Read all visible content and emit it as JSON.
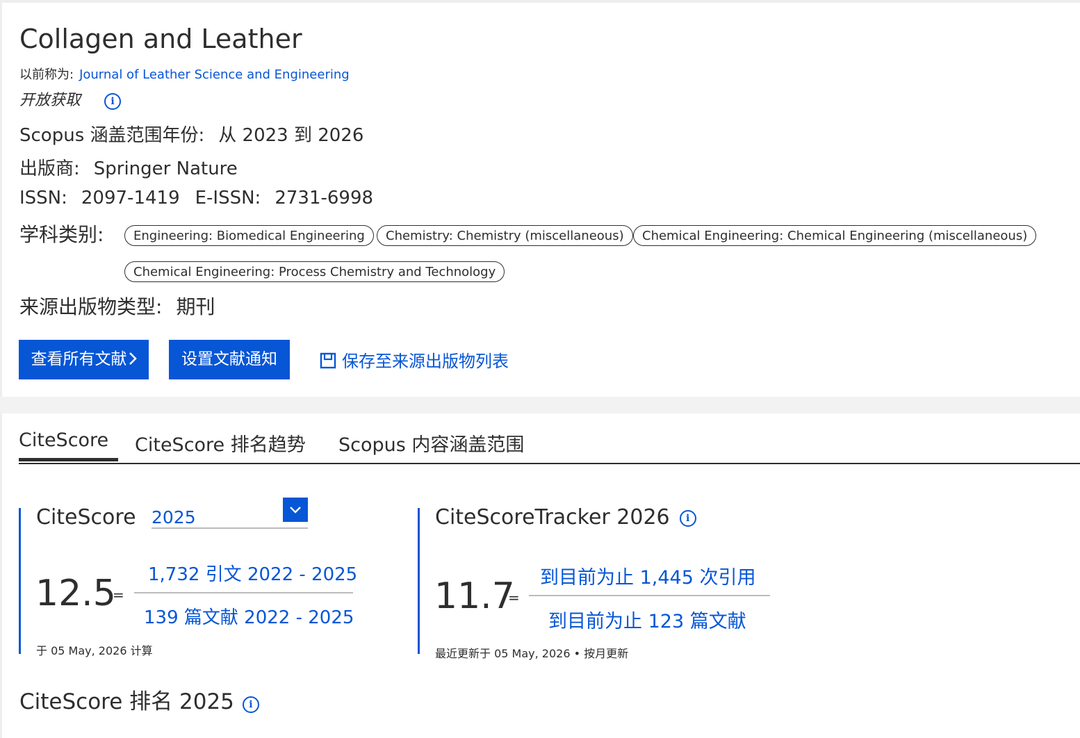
{
  "journal": {
    "title": "Collagen and Leather",
    "formerly_label": "以前称为:",
    "formerly_link": "Journal of Leather Science and Engineering",
    "open_access": "开放获取",
    "coverage_label": "Scopus 涵盖范围年份:",
    "coverage_value": "从 2023 到 2026",
    "publisher_label": "出版商:",
    "publisher_value": "Springer Nature",
    "issn_label": "ISSN:",
    "issn_value": "2097-1419",
    "eissn_label": "E-ISSN:",
    "eissn_value": "2731-6998",
    "subject_label": "学科类别:",
    "subjects": [
      "Engineering: Biomedical Engineering",
      "Chemistry: Chemistry (miscellaneous)",
      "Chemical Engineering: Chemical Engineering (miscellaneous)",
      "Chemical Engineering: Process Chemistry and Technology"
    ],
    "source_type_label": "来源出版物类型:",
    "source_type_value": "期刊"
  },
  "actions": {
    "view_all": "查看所有文献",
    "set_alert": "设置文献通知",
    "save_list": "保存至来源出版物列表"
  },
  "tabs": [
    "CiteScore",
    "CiteScore 排名趋势",
    "Scopus 内容涵盖范围"
  ],
  "citescore": {
    "label": "CiteScore",
    "year": "2025",
    "value": "12.5",
    "eq": "=",
    "numerator": "1,732 引文 2022 - 2025",
    "denominator": "139 篇文献 2022 - 2025",
    "calc_note": "于 05 May, 2026 计算"
  },
  "tracker": {
    "label": "CiteScoreTracker 2026",
    "value": "11.7",
    "eq": "=",
    "numerator": "到目前为止 1,445 次引用",
    "denominator": "到目前为止 123 篇文献",
    "update_note": "最近更新于 05 May, 2026 • 按月更新"
  },
  "rank": {
    "title": "CiteScore 排名 2025"
  },
  "colors": {
    "accent": "#0656d6",
    "text": "#2e2e2e",
    "divider": "#bbbbbb",
    "separator": "#f2f2f2"
  },
  "icons": [
    "info-icon",
    "chevron-right-icon",
    "chevron-down-icon",
    "save-icon"
  ]
}
